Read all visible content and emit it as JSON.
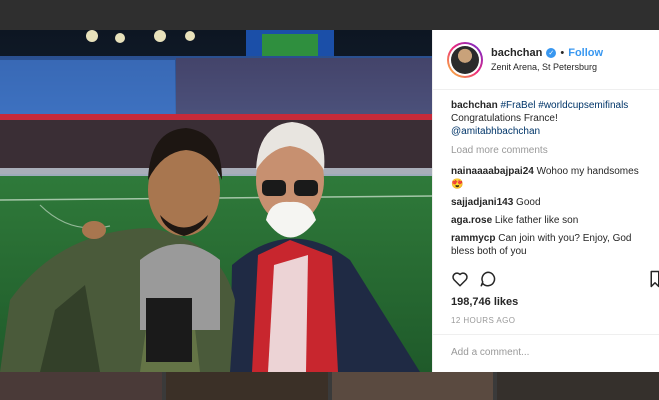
{
  "header": {
    "username": "bachchan",
    "separator": "•",
    "follow_label": "Follow",
    "location": "Zenit Arena, St Petersburg"
  },
  "caption": {
    "username": "bachchan",
    "hashtags": "#FraBel #worldcupsemifinals",
    "text": "Congratulations France!",
    "mention": "@amitabhbachchan"
  },
  "comments": {
    "load_more": "Load more comments",
    "items": [
      {
        "user": "nainaaaabajpai24",
        "text": "Wohoo my handsomes 😍"
      },
      {
        "user": "sajjadjani143",
        "text": "Good"
      },
      {
        "user": "aga.rose",
        "text": "Like father like son"
      },
      {
        "user": "rammycp",
        "text": "Can join with you? Enjoy, God bless both of you"
      }
    ]
  },
  "stats": {
    "likes": "198,746 likes",
    "time": "12 HOURS AGO"
  },
  "input": {
    "placeholder": "Add a comment..."
  },
  "colors": {
    "link_blue": "#3897f0",
    "tag_blue": "#003569",
    "muted": "#999999"
  }
}
